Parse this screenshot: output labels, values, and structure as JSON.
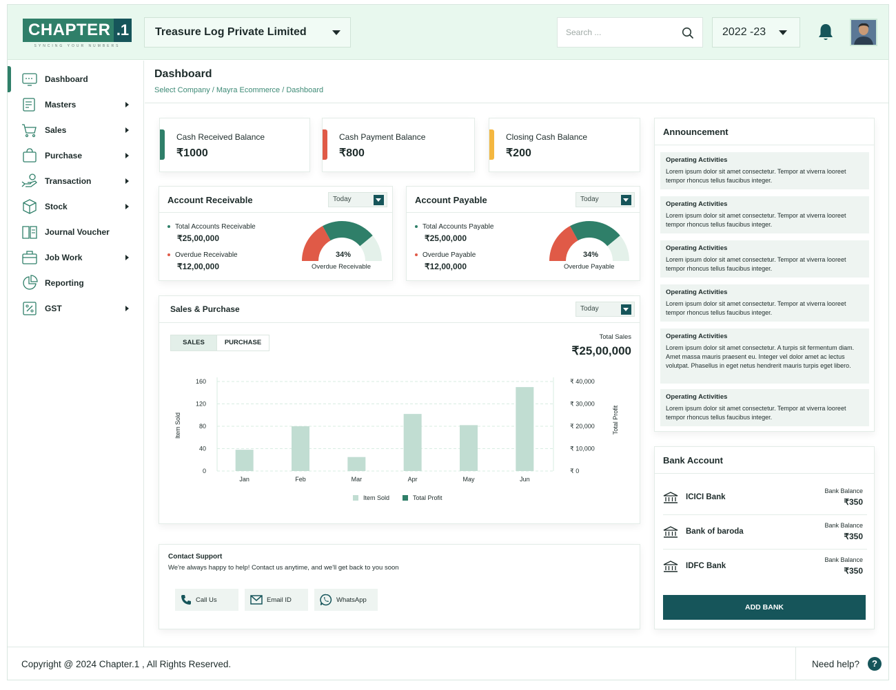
{
  "brand": {
    "logo_word": "CHAPTER",
    "logo_num": ".1",
    "tagline": "SYNCING YOUR NUMBERS",
    "accent": "#2f7f69",
    "dark": "#16555a"
  },
  "header": {
    "company": "Treasure Log Private Limited",
    "search_placeholder": "Search ...",
    "year": "2022 -23",
    "icons": [
      "search-icon",
      "bell-icon",
      "avatar"
    ]
  },
  "sidebar": {
    "items": [
      {
        "label": "Dashboard",
        "icon": "dashboard-icon",
        "has_arrow": false,
        "active": true
      },
      {
        "label": "Masters",
        "icon": "masters-icon",
        "has_arrow": true
      },
      {
        "label": "Sales",
        "icon": "cart-icon",
        "has_arrow": true
      },
      {
        "label": "Purchase",
        "icon": "bag-icon",
        "has_arrow": true
      },
      {
        "label": "Transaction",
        "icon": "transaction-icon",
        "has_arrow": true
      },
      {
        "label": "Stock",
        "icon": "box-icon",
        "has_arrow": true
      },
      {
        "label": "Journal Voucher",
        "icon": "book-icon",
        "has_arrow": false
      },
      {
        "label": "Job Work",
        "icon": "briefcase-icon",
        "has_arrow": true
      },
      {
        "label": "Reporting",
        "icon": "pie-icon",
        "has_arrow": false
      },
      {
        "label": "GST",
        "icon": "percent-icon",
        "has_arrow": true
      }
    ]
  },
  "page": {
    "title": "Dashboard",
    "breadcrumb": "Select Company / Mayra Ecommerce / Dashboard"
  },
  "balances": [
    {
      "title": "Cash Received Balance",
      "value": "₹1000",
      "color": "#2f7f69"
    },
    {
      "title": "Cash Payment Balance",
      "value": "₹800",
      "color": "#e05a47"
    },
    {
      "title": "Closing Cash Balance",
      "value": "₹200",
      "color": "#f4b740"
    }
  ],
  "receivable": {
    "title": "Account Receivable",
    "period": "Today",
    "total_label": "Total Accounts Receivable",
    "total_value": "₹25,00,000",
    "overdue_label": "Overdue Receivable",
    "overdue_value": "₹12,00,000",
    "gauge_pct": "34%",
    "gauge_label": "Overdue Receivable",
    "gauge_fraction": 0.34
  },
  "payable": {
    "title": "Account Payable",
    "period": "Today",
    "total_label": "Total Accounts Payable",
    "total_value": "₹25,00,000",
    "overdue_label": "Overdue Payable",
    "overdue_value": "₹12,00,000",
    "gauge_pct": "34%",
    "gauge_label": "Overdue Payable",
    "gauge_fraction": 0.34
  },
  "sales_purchase": {
    "title": "Sales & Purchase",
    "period": "Today",
    "tabs": [
      "SALES",
      "PURCHASE"
    ],
    "total_sales_label": "Total Sales",
    "total_sales_value": "₹25,00,000"
  },
  "chart_data": {
    "type": "bar",
    "categories": [
      "Jan",
      "Feb",
      "Mar",
      "Apr",
      "May",
      "Jun"
    ],
    "series": [
      {
        "name": "Item Sold",
        "values": [
          38,
          80,
          25,
          102,
          82,
          150
        ],
        "color": "#c1ddd2"
      },
      {
        "name": "Total Profit",
        "values": [],
        "color": "#2f7f69"
      }
    ],
    "ylabel": "Item Sold",
    "y2label": "Total Profit",
    "ylim": [
      0,
      160
    ],
    "yticks": [
      "0",
      "40",
      "80",
      "120",
      "160"
    ],
    "y2ticks": [
      "₹ 0",
      "₹ 10,000",
      "₹ 20,000",
      "₹ 30,000",
      "₹ 40,000"
    ],
    "legend": "bottom-center",
    "grid": true
  },
  "contact": {
    "title": "Contact Support",
    "text": "We're always happy to help! Contact us anytime, and we'll get back to you soon",
    "call": "Call Us",
    "email": "Email ID",
    "whatsapp": "WhatsApp"
  },
  "announcement": {
    "title": "Announcement",
    "items": [
      {
        "title": "Operating Activities",
        "body": "Lorem ipsum dolor sit amet consectetur. Tempor at viverra looreet tempor rhoncus tellus faucibus integer."
      },
      {
        "title": "Operating Activities",
        "body": "Lorem ipsum dolor sit amet consectetur. Tempor at viverra looreet tempor rhoncus tellus faucibus integer."
      },
      {
        "title": "Operating Activities",
        "body": "Lorem ipsum dolor sit amet consectetur. Tempor at viverra looreet tempor rhoncus tellus faucibus integer."
      },
      {
        "title": "Operating Activities",
        "body": "Lorem ipsum dolor sit amet consectetur. Tempor at viverra looreet tempor rhoncus tellus faucibus integer."
      },
      {
        "title": "Operating Activities",
        "body": "Lorem ipsum dolor sit amet consectetur. A turpis sit fermentum diam. Amet massa mauris praesent eu. Integer vel dolor amet ac lectus volutpat. Phasellus in eget netus hendrerit mauris turpis eget libero."
      },
      {
        "title": "Operating Activities",
        "body": "Lorem ipsum dolor sit amet consectetur. Tempor at viverra looreet tempor rhoncus tellus faucibus integer."
      }
    ]
  },
  "bank": {
    "title": "Bank Account",
    "balance_label": "Bank Balance",
    "accounts": [
      {
        "name": "ICICI Bank",
        "balance": "₹350"
      },
      {
        "name": "Bank of baroda",
        "balance": "₹350"
      },
      {
        "name": "IDFC Bank",
        "balance": "₹350"
      }
    ],
    "add_label": "ADD BANK"
  },
  "footer": {
    "copyright": "Copyright @ 2024 Chapter.1 , All Rights Reserved.",
    "help": "Need help?",
    "help_icon": "?"
  }
}
